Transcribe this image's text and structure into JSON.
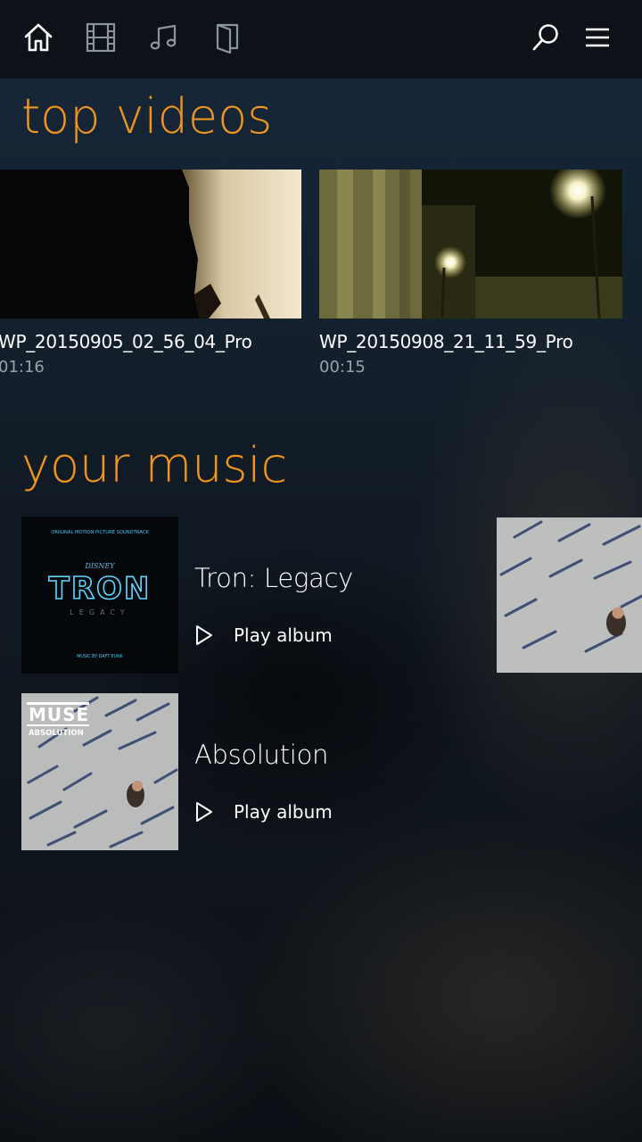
{
  "nav": {
    "items": [
      {
        "name": "home-icon",
        "active": true
      },
      {
        "name": "video-icon",
        "active": false
      },
      {
        "name": "music-icon",
        "active": false
      },
      {
        "name": "file-explorer-icon",
        "active": false
      }
    ],
    "right": [
      "search-icon",
      "menu-icon"
    ]
  },
  "sections": {
    "videos_title": "top videos",
    "music_title": "your music"
  },
  "videos": [
    {
      "title": "WP_20150905_02_56_04_Pro",
      "duration": "01:16"
    },
    {
      "title": "WP_20150908_21_11_59_Pro",
      "duration": "00:15"
    }
  ],
  "albums": [
    {
      "name": "Tron: Legacy",
      "play_label": "Play album",
      "art": {
        "top_text": "ORIGINAL MOTION PICTURE SOUNDTRACK",
        "brand": "DISNEY",
        "logo": "TRON",
        "sub": "LEGACY",
        "bottom_text": "MUSIC BY DAFT PUNK"
      }
    },
    {
      "name": "Absolution",
      "play_label": "Play album",
      "art": {
        "logo": "MUSE",
        "sub": "ABSOLUTION"
      }
    }
  ],
  "colors": {
    "accent": "#f0961e",
    "text": "#ffffff",
    "muted": "#9aa3ad",
    "topbar": "#0c1218"
  }
}
